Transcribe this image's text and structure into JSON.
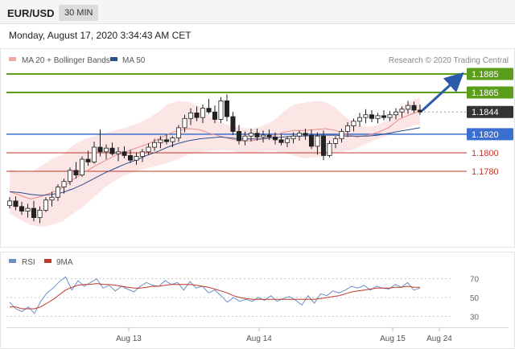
{
  "header": {
    "pair": "EUR/USD",
    "timeframe": "30 MIN"
  },
  "timestamp": "Monday, August 17, 2020 3:34:43 AM CET",
  "legend": {
    "bollinger": {
      "label": "MA 20 + Bollinger Bands",
      "color": "#f4a6a6"
    },
    "ma50": {
      "label": "MA 50",
      "color": "#2a4f8f"
    },
    "credit": "Research © 2020 Trading Central"
  },
  "rsi_legend": {
    "rsi": {
      "label": "RSI",
      "color": "#6b8fc7"
    },
    "ma9": {
      "label": "9MA",
      "color": "#c0392b"
    }
  },
  "colors": {
    "up": "#ffffff",
    "down": "#222222",
    "green": "#5a9e1a",
    "blue": "#3a6fd0",
    "red": "#c0392b",
    "current": "#333333"
  },
  "chart_data": [
    {
      "type": "candlestick",
      "title": "",
      "ylim": [
        1.1705,
        1.1905
      ],
      "x_tick_labels": [
        "Aug 13",
        "Aug 14",
        "Aug 15",
        "Aug 24"
      ],
      "levels": [
        {
          "value": 1.1885,
          "label": "1.1885",
          "kind": "resistance"
        },
        {
          "value": 1.1865,
          "label": "1.1865",
          "kind": "resistance"
        },
        {
          "value": 1.1844,
          "label": "1.1844",
          "kind": "current"
        },
        {
          "value": 1.182,
          "label": "1.1820",
          "kind": "pivot"
        },
        {
          "value": 1.18,
          "label": "1.1800",
          "kind": "support"
        },
        {
          "value": 1.178,
          "label": "1.1780",
          "kind": "support"
        }
      ],
      "arrow": {
        "from": 1.1844,
        "to": 1.1885
      },
      "candles": [
        [
          1.1743,
          1.1752,
          1.174,
          1.1748
        ],
        [
          1.1748,
          1.1753,
          1.1738,
          1.1742
        ],
        [
          1.1742,
          1.1747,
          1.1733,
          1.1737
        ],
        [
          1.1737,
          1.1745,
          1.173,
          1.174
        ],
        [
          1.174,
          1.1748,
          1.1726,
          1.173
        ],
        [
          1.173,
          1.1742,
          1.1724,
          1.1738
        ],
        [
          1.1738,
          1.1752,
          1.1736,
          1.1749
        ],
        [
          1.1749,
          1.1758,
          1.1742,
          1.1752
        ],
        [
          1.1752,
          1.1766,
          1.1748,
          1.1763
        ],
        [
          1.1763,
          1.1772,
          1.1756,
          1.1769
        ],
        [
          1.1769,
          1.1784,
          1.1765,
          1.1781
        ],
        [
          1.1781,
          1.179,
          1.1772,
          1.1776
        ],
        [
          1.1776,
          1.1796,
          1.1774,
          1.1793
        ],
        [
          1.1793,
          1.1802,
          1.1786,
          1.179
        ],
        [
          1.179,
          1.1812,
          1.1788,
          1.1806
        ],
        [
          1.1806,
          1.1825,
          1.1796,
          1.1801
        ],
        [
          1.1801,
          1.1809,
          1.1793,
          1.1805
        ],
        [
          1.1805,
          1.1811,
          1.1797,
          1.1799
        ],
        [
          1.1799,
          1.1806,
          1.1791,
          1.1801
        ],
        [
          1.1801,
          1.1807,
          1.1794,
          1.1797
        ],
        [
          1.1797,
          1.1803,
          1.1789,
          1.1792
        ],
        [
          1.1792,
          1.18,
          1.1787,
          1.1796
        ],
        [
          1.1796,
          1.1804,
          1.179,
          1.1801
        ],
        [
          1.1801,
          1.181,
          1.1798,
          1.1806
        ],
        [
          1.1806,
          1.1815,
          1.1802,
          1.1811
        ],
        [
          1.1811,
          1.1818,
          1.1805,
          1.1814
        ],
        [
          1.1814,
          1.182,
          1.1809,
          1.1812
        ],
        [
          1.1812,
          1.1818,
          1.1806,
          1.1816
        ],
        [
          1.1816,
          1.183,
          1.1812,
          1.1827
        ],
        [
          1.1827,
          1.1841,
          1.1822,
          1.1837
        ],
        [
          1.1837,
          1.1848,
          1.183,
          1.1843
        ],
        [
          1.1843,
          1.185,
          1.1834,
          1.1838
        ],
        [
          1.1838,
          1.1852,
          1.1832,
          1.1848
        ],
        [
          1.1848,
          1.1858,
          1.1842,
          1.1844
        ],
        [
          1.1844,
          1.1851,
          1.1832,
          1.1836
        ],
        [
          1.1836,
          1.186,
          1.1832,
          1.1856
        ],
        [
          1.1856,
          1.1863,
          1.1834,
          1.1839
        ],
        [
          1.1839,
          1.1844,
          1.1819,
          1.1823
        ],
        [
          1.1823,
          1.183,
          1.1809,
          1.1813
        ],
        [
          1.1813,
          1.1823,
          1.1808,
          1.1818
        ],
        [
          1.1818,
          1.1826,
          1.1812,
          1.1821
        ],
        [
          1.1821,
          1.1826,
          1.1813,
          1.1817
        ],
        [
          1.1817,
          1.1824,
          1.1811,
          1.1819
        ],
        [
          1.1819,
          1.1825,
          1.1814,
          1.1817
        ],
        [
          1.1817,
          1.1822,
          1.1809,
          1.1814
        ],
        [
          1.1814,
          1.182,
          1.1808,
          1.1811
        ],
        [
          1.1811,
          1.1818,
          1.1806,
          1.1815
        ],
        [
          1.1815,
          1.1822,
          1.181,
          1.1818
        ],
        [
          1.1818,
          1.1824,
          1.1813,
          1.1821
        ],
        [
          1.1821,
          1.1826,
          1.1814,
          1.1819
        ],
        [
          1.1819,
          1.1825,
          1.1804,
          1.1807
        ],
        [
          1.1807,
          1.1822,
          1.1798,
          1.1818
        ],
        [
          1.1818,
          1.1824,
          1.1792,
          1.1797
        ],
        [
          1.1797,
          1.1813,
          1.1795,
          1.181
        ],
        [
          1.181,
          1.1818,
          1.1805,
          1.1815
        ],
        [
          1.1815,
          1.1826,
          1.1811,
          1.1823
        ],
        [
          1.1823,
          1.1833,
          1.1817,
          1.1829
        ],
        [
          1.1829,
          1.1837,
          1.1823,
          1.1834
        ],
        [
          1.1834,
          1.1843,
          1.1828,
          1.1838
        ],
        [
          1.1838,
          1.1847,
          1.1832,
          1.1841
        ],
        [
          1.1841,
          1.1846,
          1.1833,
          1.1837
        ],
        [
          1.1837,
          1.1843,
          1.1832,
          1.184
        ],
        [
          1.184,
          1.1846,
          1.1835,
          1.1838
        ],
        [
          1.1838,
          1.1845,
          1.1834,
          1.1841
        ],
        [
          1.1841,
          1.1848,
          1.1836,
          1.1844
        ],
        [
          1.1844,
          1.185,
          1.1838,
          1.1847
        ],
        [
          1.1847,
          1.1856,
          1.1842,
          1.1851
        ],
        [
          1.1851,
          1.1855,
          1.1843,
          1.1846
        ],
        [
          1.1846,
          1.1852,
          1.1841,
          1.1844
        ]
      ],
      "bb_upper": [
        1.1782,
        1.178,
        1.1779,
        1.1786,
        1.1793,
        1.1798,
        1.1808,
        1.1814,
        1.1818,
        1.1821,
        1.1824,
        1.1827,
        1.1831,
        1.1836,
        1.1843,
        1.1852,
        1.1856,
        1.1855,
        1.185,
        1.184,
        1.1833,
        1.1829,
        1.1827,
        1.1826,
        1.1829,
        1.1834,
        1.1844,
        1.1852,
        1.1854,
        1.1856,
        1.1855,
        1.1848,
        1.1838,
        1.183,
        1.1828,
        1.183,
        1.1836,
        1.1848,
        1.1855,
        1.186
      ],
      "bb_lower": [
        1.1734,
        1.1728,
        1.1722,
        1.172,
        1.1722,
        1.1726,
        1.1734,
        1.1742,
        1.1752,
        1.1762,
        1.177,
        1.1776,
        1.178,
        1.1783,
        1.1786,
        1.1789,
        1.1793,
        1.1798,
        1.18,
        1.1802,
        1.1803,
        1.1802,
        1.18,
        1.18,
        1.1801,
        1.1802,
        1.18,
        1.1797,
        1.1794,
        1.1795,
        1.1797,
        1.18,
        1.1802,
        1.1805,
        1.181,
        1.1815,
        1.1819,
        1.1824,
        1.1828,
        1.1831
      ],
      "ma20": [
        1.1758,
        1.1754,
        1.175,
        1.1753,
        1.1757,
        1.1762,
        1.1771,
        1.1778,
        1.1785,
        1.1791,
        1.1797,
        1.1801,
        1.1805,
        1.1809,
        1.1814,
        1.182,
        1.1824,
        1.1826,
        1.1825,
        1.1821,
        1.1818,
        1.1815,
        1.1813,
        1.1813,
        1.1815,
        1.1818,
        1.1822,
        1.1824,
        1.1824,
        1.1825,
        1.1826,
        1.1824,
        1.182,
        1.1817,
        1.1819,
        1.1822,
        1.1827,
        1.1836,
        1.1841,
        1.1845
      ],
      "ma50": [
        1.1758,
        1.1757,
        1.1755,
        1.1754,
        1.1755,
        1.1757,
        1.1761,
        1.1766,
        1.1772,
        1.1778,
        1.1783,
        1.1788,
        1.1792,
        1.1797,
        1.1801,
        1.1806,
        1.181,
        1.1813,
        1.1815,
        1.1816,
        1.1817,
        1.1816,
        1.1815,
        1.1815,
        1.1815,
        1.1816,
        1.1817,
        1.1818,
        1.1818,
        1.1819,
        1.1819,
        1.1819,
        1.1818,
        1.1818,
        1.1818,
        1.1819,
        1.1821,
        1.1823,
        1.1825,
        1.1827
      ]
    },
    {
      "type": "line",
      "title": "",
      "ylim": [
        20,
        80
      ],
      "y_tick_labels": [
        "70",
        "50",
        "30"
      ],
      "y_ticks": [
        70,
        50,
        30
      ],
      "x_tick_labels": [
        "Aug 13",
        "Aug 14",
        "Aug 15",
        "Aug 24"
      ],
      "series": [
        {
          "name": "RSI",
          "values": [
            45,
            38,
            35,
            40,
            33,
            46,
            55,
            60,
            67,
            72,
            58,
            68,
            62,
            66,
            70,
            60,
            63,
            57,
            62,
            59,
            56,
            62,
            66,
            63,
            62,
            68,
            64,
            66,
            58,
            67,
            60,
            62,
            55,
            58,
            52,
            45,
            50,
            46,
            48,
            46,
            50,
            47,
            52,
            46,
            49,
            51,
            47,
            42,
            52,
            44,
            54,
            52,
            57,
            55,
            58,
            62,
            60,
            63,
            58,
            62,
            60,
            59,
            64,
            61,
            66,
            58,
            60
          ]
        },
        {
          "name": "9MA",
          "values": [
            40,
            40,
            38,
            38,
            38,
            40,
            44,
            48,
            53,
            58,
            61,
            63,
            64,
            64,
            65,
            64,
            64,
            63,
            62,
            61,
            60,
            60,
            61,
            62,
            62,
            63,
            64,
            64,
            64,
            64,
            63,
            62,
            61,
            59,
            57,
            55,
            52,
            50,
            49,
            48,
            48,
            48,
            48,
            48,
            48,
            48,
            48,
            48,
            48,
            48,
            49,
            50,
            51,
            52,
            54,
            56,
            57,
            58,
            59,
            60,
            60,
            60,
            61,
            61,
            62,
            61,
            61
          ]
        }
      ]
    }
  ]
}
